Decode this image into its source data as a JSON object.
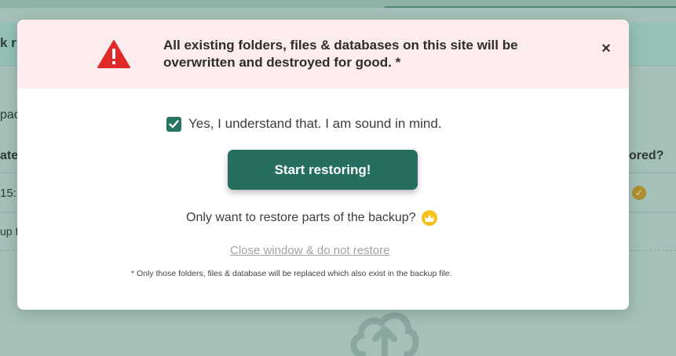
{
  "background": {
    "notice_text": "k r",
    "row_text_1": "pac",
    "column_header_left": "ate",
    "column_header_right": "ored?",
    "cell_left": "15:",
    "row_text_2": "up fi"
  },
  "modal": {
    "warning_text": "All existing folders, files & databases on this site will be overwritten and destroyed for good. *",
    "close_symbol": "×",
    "confirm_label": "Yes, I understand that. I am sound in mind.",
    "confirm_checked": true,
    "start_button_label": "Start restoring!",
    "partial_restore_text": "Only want to restore parts of the backup?",
    "close_link_label": "Close window & do not restore",
    "footnote": "* Only those folders, files & database will be replaced which also exist in the backup file."
  },
  "icons": {
    "warning": "warning-triangle-icon",
    "crown": "crown-icon",
    "check": "checkmark-icon",
    "upload": "cloud-upload-icon"
  },
  "colors": {
    "primary": "#256e60",
    "warning_bg": "#fdeced",
    "warning_icon": "#e02a2a",
    "crown": "#f5c21b"
  }
}
